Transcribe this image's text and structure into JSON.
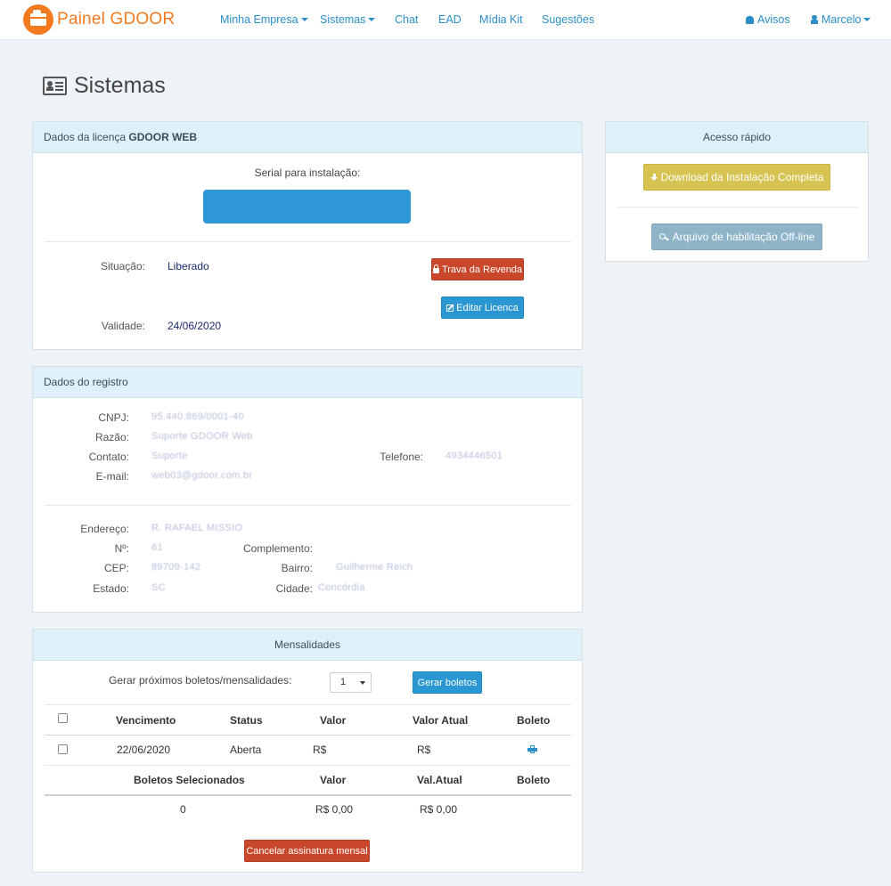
{
  "brand": {
    "name": "Painel GDOOR"
  },
  "nav": {
    "minha_empresa": "Minha Empresa",
    "sistemas": "Sistemas",
    "chat": "Chat",
    "ead": "EAD",
    "midia_kit": "Mídia Kit",
    "sugestoes": "Sugestões",
    "avisos": "Avisos",
    "user": "Marcelo"
  },
  "page": {
    "title": "Sistemas"
  },
  "licenca": {
    "heading_prefix": "Dados da licença",
    "heading_product": "GDOOR WEB",
    "serial_label": "Serial para instalação:",
    "situacao_label": "Situação:",
    "situacao_value": "Liberado",
    "validade_label": "Validade:",
    "validade_value": "24/06/2020",
    "trava_button": "Trava da Revenda",
    "editar_button": "Editar Licenca"
  },
  "acesso": {
    "heading": "Acesso rápido",
    "download_button": "Download da Instalação Completa",
    "arquivo_button": "Arquivo de habilitação Off-line"
  },
  "registro": {
    "heading": "Dados do registro",
    "cnpj_label": "CNPJ:",
    "cnpj_value": "95.440.869/0001-40",
    "razao_label": "Razão:",
    "razao_value": "Suporte GDOOR Web",
    "contato_label": "Contato:",
    "contato_value": "Suporte",
    "telefone_label": "Telefone:",
    "telefone_value": "4934446501",
    "email_label": "E-mail:",
    "email_value": "web03@gdoor.com.br",
    "endereco_label": "Endereço:",
    "endereco_value": "R. RAFAEL MISSIO",
    "numero_label": "Nº:",
    "numero_value": "61",
    "complemento_label": "Complemento:",
    "cep_label": "CEP:",
    "cep_value": "89709-142",
    "bairro_label": "Bairro:",
    "bairro_value": "Guilherme Reich",
    "estado_label": "Estado:",
    "estado_value": "SC",
    "cidade_label": "Cidade:",
    "cidade_value": "Concórdia"
  },
  "mensalidades": {
    "heading": "Mensalidades",
    "gerar_label": "Gerar próximos boletos/mensalidades:",
    "gerar_select": "1",
    "gerar_button": "Gerar boletos",
    "columns": [
      "Vencimento",
      "Status",
      "Valor",
      "Valor Atual",
      "Boleto"
    ],
    "rows": [
      {
        "vencimento": "22/06/2020",
        "status": "Aberta",
        "valor": "R$",
        "valor_atual": "R$"
      }
    ],
    "summary_columns": [
      "Boletos Selecionados",
      "Valor",
      "Val.Atual",
      "Boleto"
    ],
    "summary": {
      "selecionados": "0",
      "valor": "R$ 0,00",
      "val_atual": "R$ 0,00"
    },
    "cancelar_button": "Cancelar assinatura mensal"
  },
  "colors": {
    "brand_orange": "#f47a20",
    "link_blue": "#2a8fc8",
    "panel_heading": "#dff0f8",
    "button_red": "#c9472a",
    "button_blue": "#2a97d3",
    "button_gold": "#d6c352",
    "button_gray": "#8fb4c8"
  }
}
